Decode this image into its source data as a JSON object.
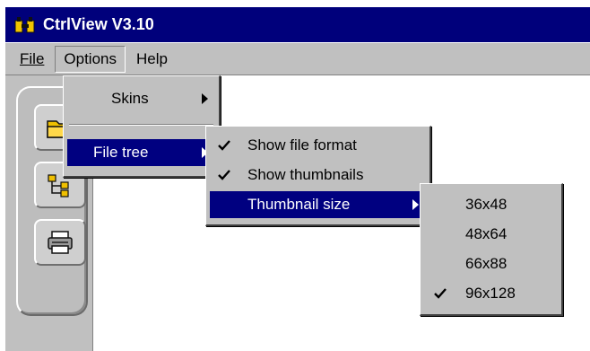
{
  "window": {
    "title": "CtrlView V3.10"
  },
  "menubar": {
    "items": [
      {
        "label": "File"
      },
      {
        "label": "Options"
      },
      {
        "label": "Help"
      }
    ]
  },
  "options_menu": {
    "items": [
      {
        "label": "Skins"
      },
      {
        "label": "File tree"
      }
    ]
  },
  "file_tree_menu": {
    "items": [
      {
        "label": "Show file format",
        "checked": true
      },
      {
        "label": "Show thumbnails",
        "checked": true
      },
      {
        "label": "Thumbnail size",
        "checked": false
      }
    ]
  },
  "thumbnail_size_menu": {
    "items": [
      {
        "label": "36x48",
        "checked": false
      },
      {
        "label": "48x64",
        "checked": false
      },
      {
        "label": "66x88",
        "checked": false
      },
      {
        "label": "96x128",
        "checked": true
      }
    ]
  },
  "toolbar": {
    "icons": [
      "folder-open-icon",
      "file-tree-icon",
      "printer-icon"
    ]
  },
  "colors": {
    "titlebar": "#00007b",
    "menu_face": "#c0c0c0",
    "highlight": "#000080",
    "text": "#000000"
  }
}
